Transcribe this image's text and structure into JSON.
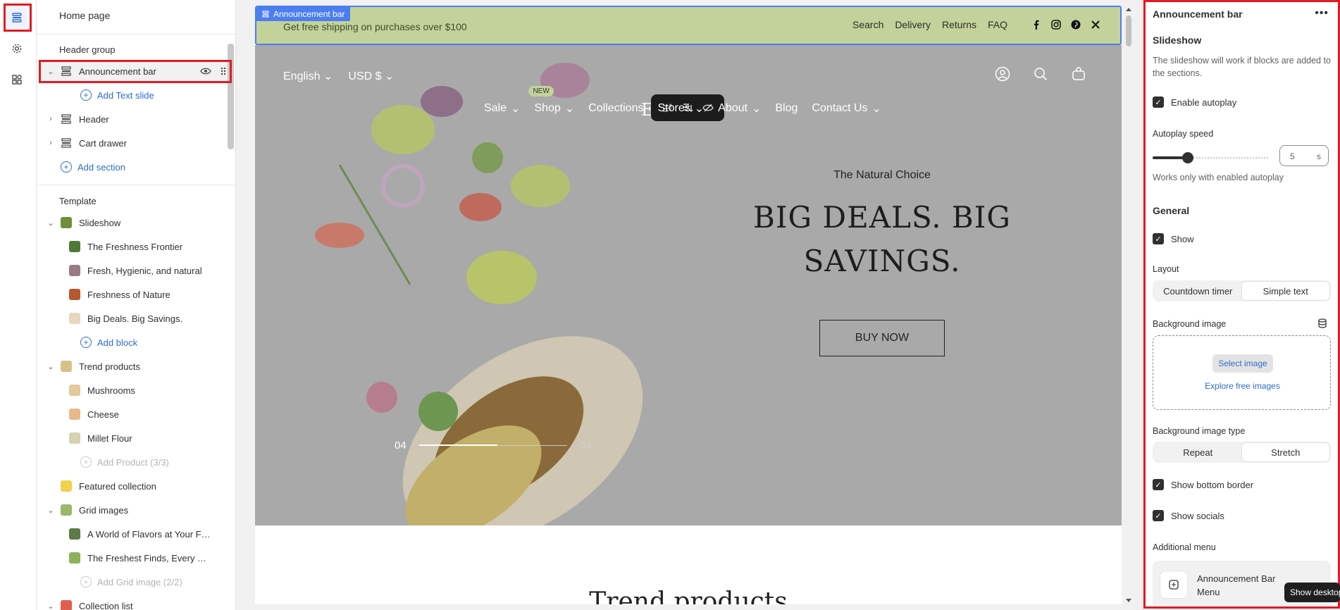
{
  "sidebar": {
    "title": "Home page",
    "header_group_label": "Header group",
    "header_items": [
      {
        "label": "Announcement bar",
        "add": "Add Text slide"
      },
      {
        "label": "Header"
      },
      {
        "label": "Cart drawer"
      }
    ],
    "add_section": "Add section",
    "template_label": "Template",
    "slideshow": {
      "label": "Slideshow",
      "blocks": [
        "The Freshness Frontier",
        "Fresh, Hygienic, and natural",
        "Freshness of Nature",
        "Big Deals. Big Savings."
      ],
      "add": "Add block"
    },
    "trend": {
      "label": "Trend products",
      "blocks": [
        "Mushrooms",
        "Cheese",
        "Millet Flour"
      ],
      "add": "Add Product (3/3)"
    },
    "featured": "Featured collection",
    "grid": {
      "label": "Grid images",
      "blocks": [
        "A World of Flavors at Your Fi...",
        "The Freshest Finds, Every Time"
      ],
      "add": "Add Grid image (2/2)"
    },
    "collection_list": "Collection list"
  },
  "preview": {
    "ann_tag": "Announcement bar",
    "ann_text": "Get free shipping on purchases over $100",
    "ann_links": [
      "Search",
      "Delivery",
      "Returns",
      "FAQ"
    ],
    "lang": "English",
    "currency": "USD $",
    "logo": "E      E",
    "nav": [
      "Sale",
      "Shop",
      "Collections",
      "Stores",
      "About",
      "Blog",
      "Contact Us"
    ],
    "nav_badge": "NEW",
    "hero_kicker": "The Natural Choice",
    "hero_title": "BIG DEALS. BIG SAVINGS.",
    "hero_button": "BUY NOW",
    "slide_current": "04",
    "slide_total": "04",
    "slide_progress": 0.53,
    "trend_title": "Trend products"
  },
  "settings": {
    "title": "Announcement bar",
    "slideshow_h": "Slideshow",
    "slideshow_p": "The slideshow will work if blocks are added to the sections.",
    "enable_autoplay": "Enable autoplay",
    "autoplay_speed": "Autoplay speed",
    "speed_value": "5",
    "speed_unit": "s",
    "speed_note": "Works only with enabled autoplay",
    "general_h": "General",
    "show": "Show",
    "layout_label": "Layout",
    "layout_options": [
      "Countdown timer",
      "Simple text"
    ],
    "bg_image_label": "Background image",
    "select_image": "Select image",
    "explore_images": "Explore free images",
    "bg_type_label": "Background image type",
    "bg_type_options": [
      "Repeat",
      "Stretch"
    ],
    "show_bottom_border": "Show bottom border",
    "show_socials": "Show socials",
    "additional_menu": "Additional menu",
    "menu_name": "Announcement Bar Menu",
    "tooltip": "Show desktop"
  }
}
